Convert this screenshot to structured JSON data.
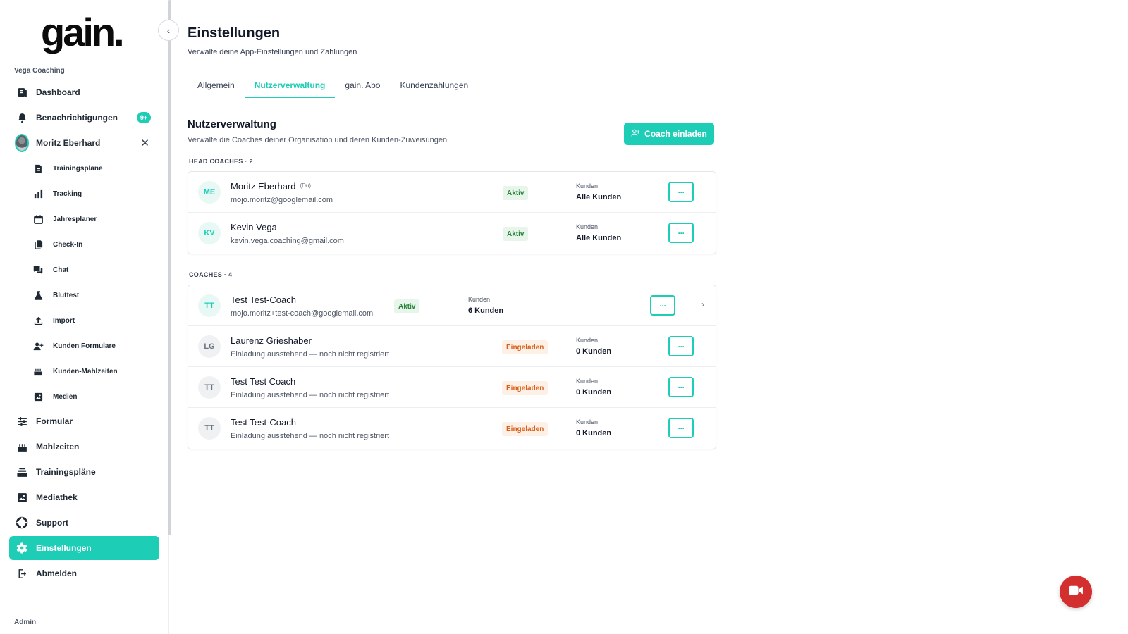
{
  "brand": {
    "logo": "gain.",
    "accent": "#1ecdb6"
  },
  "sidebar": {
    "org": "Vega Coaching",
    "admin_label": "Admin",
    "top_items": [
      {
        "label": "Dashboard",
        "icon": "dashboard-icon"
      },
      {
        "label": "Benachrichtigungen",
        "icon": "bell-icon",
        "badge": "9+"
      },
      {
        "label": "Moritz Eberhard",
        "icon": "avatar"
      }
    ],
    "sub_items": [
      {
        "label": "Trainingspläne",
        "icon": "document-icon"
      },
      {
        "label": "Tracking",
        "icon": "bar-chart-icon"
      },
      {
        "label": "Jahresplaner",
        "icon": "calendar-icon"
      },
      {
        "label": "Check-In",
        "icon": "files-icon"
      },
      {
        "label": "Chat",
        "icon": "chat-icon"
      },
      {
        "label": "Bluttest",
        "icon": "flask-icon"
      },
      {
        "label": "Import",
        "icon": "upload-icon"
      },
      {
        "label": "Kunden Formulare",
        "icon": "user-plus-icon"
      },
      {
        "label": "Kunden-Mahlzeiten",
        "icon": "cake-icon"
      },
      {
        "label": "Medien",
        "icon": "image-icon"
      }
    ],
    "bottom_items": [
      {
        "label": "Formular",
        "icon": "sliders-icon"
      },
      {
        "label": "Mahlzeiten",
        "icon": "cake-icon"
      },
      {
        "label": "Trainingspläne",
        "icon": "stack-icon"
      },
      {
        "label": "Mediathek",
        "icon": "image-icon"
      },
      {
        "label": "Support",
        "icon": "lifebuoy-icon"
      },
      {
        "label": "Einstellungen",
        "icon": "gear-icon",
        "active": true
      },
      {
        "label": "Abmelden",
        "icon": "logout-icon"
      }
    ]
  },
  "header": {
    "title": "Einstellungen",
    "subtitle": "Verwalte deine App-Einstellungen und Zahlungen"
  },
  "tabs": [
    {
      "label": "Allgemein"
    },
    {
      "label": "Nutzerverwaltung",
      "active": true
    },
    {
      "label": "gain. Abo"
    },
    {
      "label": "Kundenzahlungen"
    }
  ],
  "section": {
    "title": "Nutzerverwaltung",
    "subtitle": "Verwalte die Coaches deiner Organisation und deren Kunden-Zuweisungen.",
    "invite_label": "Coach einladen"
  },
  "head_coaches": {
    "label": "HEAD COACHES · 2",
    "rows": [
      {
        "initials": "ME",
        "name": "Moritz Eberhard",
        "tag": "(Du)",
        "sub": "mojo.moritz@googlemail.com",
        "status": "Aktiv",
        "kunden_label": "Kunden",
        "kunden": "Alle Kunden"
      },
      {
        "initials": "KV",
        "name": "Kevin Vega",
        "tag": "",
        "sub": "kevin.vega.coaching@gmail.com",
        "status": "Aktiv",
        "kunden_label": "Kunden",
        "kunden": "Alle Kunden"
      }
    ]
  },
  "coaches": {
    "label": "COACHES · 4",
    "rows": [
      {
        "initials": "TT",
        "name": "Test Test-Coach",
        "sub": "mojo.moritz+test-coach@googlemail.com",
        "status": "Aktiv",
        "kunden_label": "Kunden",
        "kunden": "6 Kunden"
      },
      {
        "initials": "LG",
        "name": "Laurenz Grieshaber",
        "sub": "Einladung ausstehend — noch nicht registriert",
        "status": "Eingeladen",
        "kunden_label": "Kunden",
        "kunden": "0 Kunden"
      },
      {
        "initials": "TT",
        "name": "Test Test Coach",
        "sub": "Einladung ausstehend — noch nicht registriert",
        "status": "Eingeladen",
        "kunden_label": "Kunden",
        "kunden": "0 Kunden"
      },
      {
        "initials": "TT",
        "name": "Test Test-Coach",
        "sub": "Einladung ausstehend — noch nicht registriert",
        "status": "Eingeladen",
        "kunden_label": "Kunden",
        "kunden": "0 Kunden"
      }
    ]
  },
  "more_label": "···",
  "video_button": {
    "icon": "video-camera-icon",
    "color": "#d32f2f"
  }
}
